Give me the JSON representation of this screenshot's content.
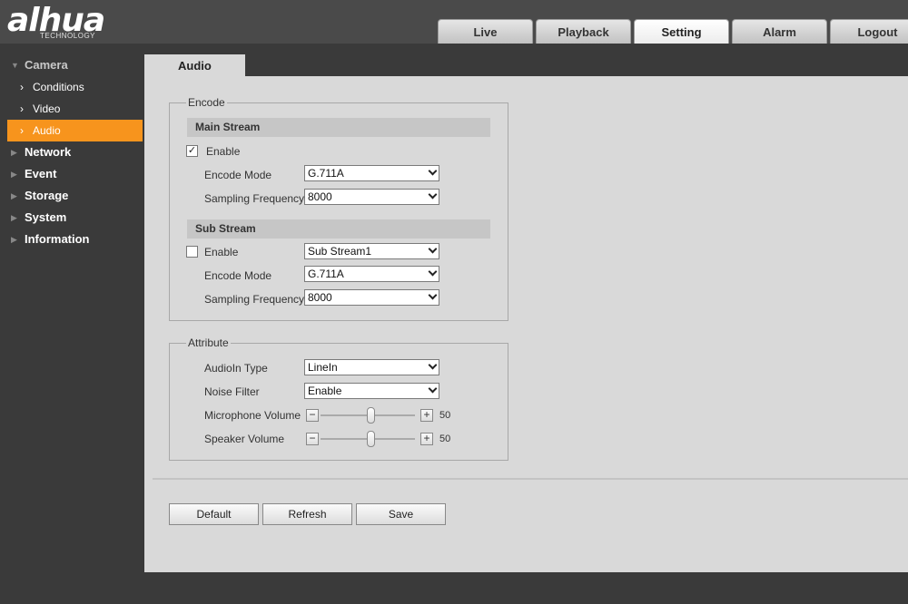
{
  "brand": {
    "logo": "alhua",
    "sub": "TECHNOLOGY"
  },
  "tabs": [
    {
      "label": "Live",
      "active": false
    },
    {
      "label": "Playback",
      "active": false
    },
    {
      "label": "Setting",
      "active": true
    },
    {
      "label": "Alarm",
      "active": false
    },
    {
      "label": "Logout",
      "active": false
    }
  ],
  "sidebar": {
    "camera": "Camera",
    "camera_items": [
      "Conditions",
      "Video",
      "Audio"
    ],
    "active_item": "Audio",
    "sections": [
      "Network",
      "Event",
      "Storage",
      "System",
      "Information"
    ]
  },
  "content_tab": "Audio",
  "encode": {
    "legend": "Encode",
    "main": {
      "heading": "Main Stream",
      "enable_label": "Enable",
      "enabled": true,
      "encode_mode_label": "Encode Mode",
      "encode_mode": "G.711A",
      "sampling_label": "Sampling Frequency",
      "sampling": "8000"
    },
    "sub": {
      "heading": "Sub Stream",
      "enable_label": "Enable",
      "enabled": false,
      "stream": "Sub Stream1",
      "encode_mode_label": "Encode Mode",
      "encode_mode": "G.711A",
      "sampling_label": "Sampling Frequency",
      "sampling": "8000"
    }
  },
  "attribute": {
    "legend": "Attribute",
    "audioin_label": "AudioIn Type",
    "audioin": "LineIn",
    "noise_label": "Noise Filter",
    "noise": "Enable",
    "mic_label": "Microphone Volume",
    "mic_value": "50",
    "speaker_label": "Speaker Volume",
    "speaker_value": "50"
  },
  "buttons": {
    "default": "Default",
    "refresh": "Refresh",
    "save": "Save"
  },
  "colors": {
    "accent": "#f7941d",
    "header": "#4a4a4a",
    "panel": "#d9d9d9"
  }
}
